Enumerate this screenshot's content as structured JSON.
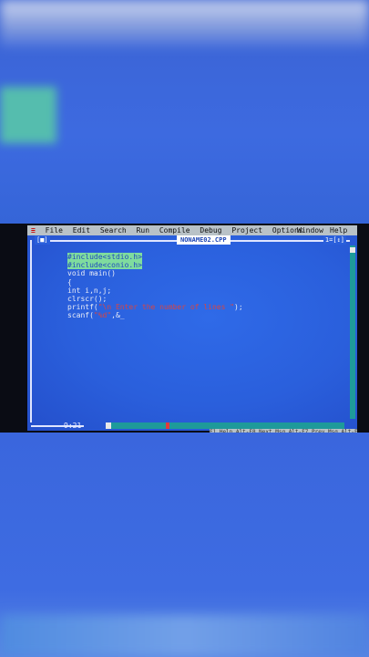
{
  "menu": {
    "items": [
      "File",
      "Edit",
      "Search",
      "Run",
      "Compile",
      "Debug",
      "Project",
      "Options"
    ],
    "right_items": [
      "Window",
      "Help"
    ],
    "system_glyph": "≡"
  },
  "window": {
    "filename": "NONAME02.CPP",
    "close_glyph": "[■]",
    "number": "1=[↕]"
  },
  "code": {
    "lines": [
      "#include<stdio.h>",
      "#include<conio.h>",
      "void main()",
      "{",
      "int i,n,j;",
      "clrscr();",
      "printf(\"\\n Enter the number of lines \");",
      "scanf(\"%d\",&_"
    ]
  },
  "status": {
    "position": "9:21",
    "hint_text": "F1 Help  Alt-F8 Next Msg  Alt-F7 Prev Msg  Alt-F9 Compile  F9 Make  F10 Menu"
  }
}
